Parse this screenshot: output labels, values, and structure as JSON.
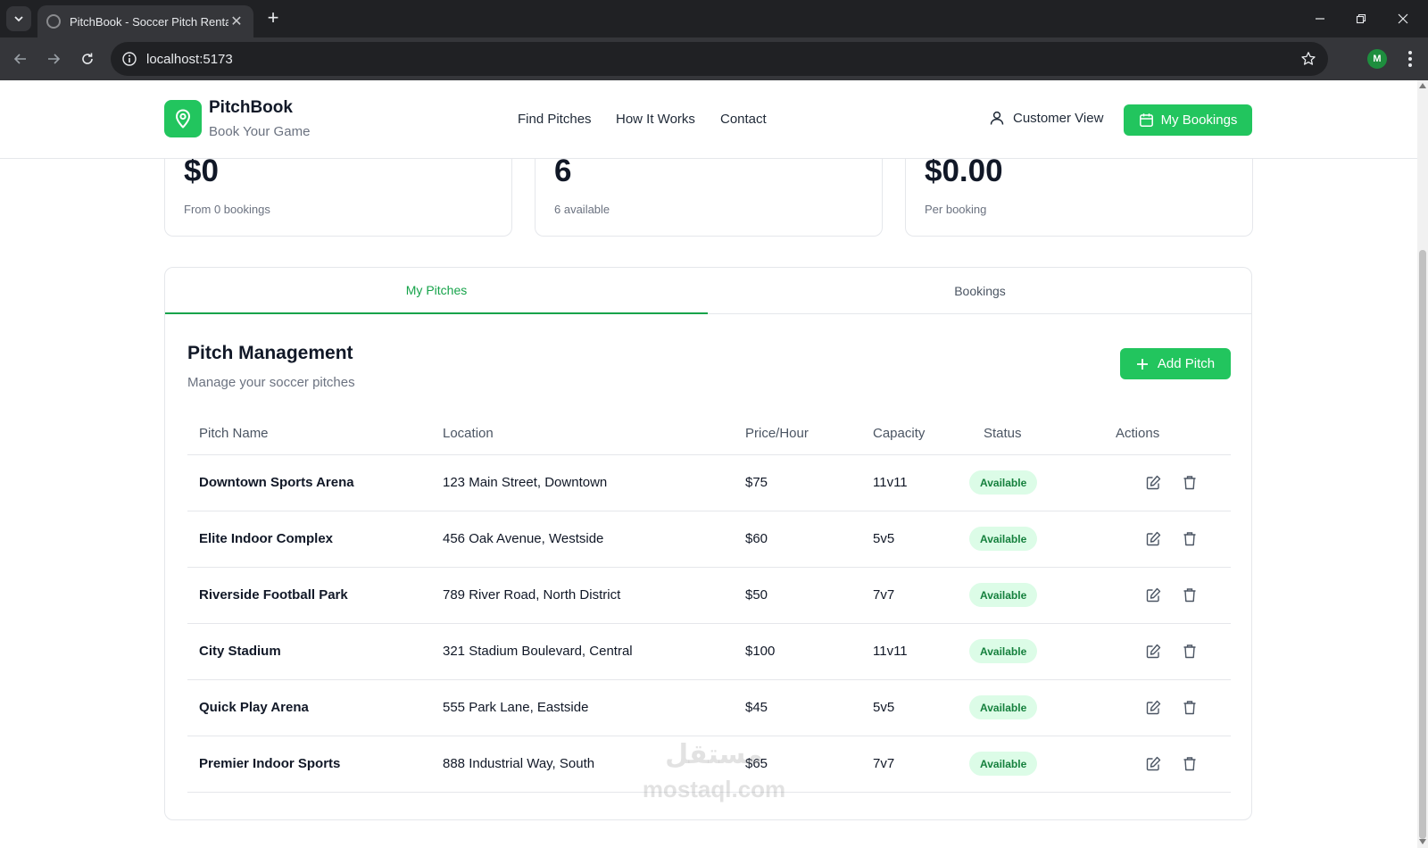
{
  "browser": {
    "tab_title": "PitchBook - Soccer Pitch Rental",
    "url": "localhost:5173",
    "profile_initial": "M"
  },
  "header": {
    "brand_name": "PitchBook",
    "brand_tagline": "Book Your Game",
    "nav": [
      "Find Pitches",
      "How It Works",
      "Contact"
    ],
    "customer_view": "Customer View",
    "my_bookings": "My Bookings"
  },
  "stats": [
    {
      "value": "$0",
      "sub": "From 0 bookings"
    },
    {
      "value": "6",
      "sub": "6 available"
    },
    {
      "value": "$0.00",
      "sub": "Per booking"
    }
  ],
  "tabs": [
    "My Pitches",
    "Bookings"
  ],
  "management": {
    "title": "Pitch Management",
    "subtitle": "Manage your soccer pitches",
    "add_button": "Add Pitch"
  },
  "table": {
    "headers": [
      "Pitch Name",
      "Location",
      "Price/Hour",
      "Capacity",
      "Status",
      "Actions"
    ],
    "rows": [
      {
        "name": "Downtown Sports Arena",
        "location": "123 Main Street, Downtown",
        "price": "$75",
        "capacity": "11v11",
        "status": "Available"
      },
      {
        "name": "Elite Indoor Complex",
        "location": "456 Oak Avenue, Westside",
        "price": "$60",
        "capacity": "5v5",
        "status": "Available"
      },
      {
        "name": "Riverside Football Park",
        "location": "789 River Road, North District",
        "price": "$50",
        "capacity": "7v7",
        "status": "Available"
      },
      {
        "name": "City Stadium",
        "location": "321 Stadium Boulevard, Central",
        "price": "$100",
        "capacity": "11v11",
        "status": "Available"
      },
      {
        "name": "Quick Play Arena",
        "location": "555 Park Lane, Eastside",
        "price": "$45",
        "capacity": "5v5",
        "status": "Available"
      },
      {
        "name": "Premier Indoor Sports",
        "location": "888 Industrial Way, South",
        "price": "$65",
        "capacity": "7v7",
        "status": "Available"
      }
    ]
  },
  "watermark": {
    "line1": "مستقل",
    "line2": "mostaql.com"
  },
  "colors": {
    "accent": "#22c55e",
    "accent_dark": "#16a34a",
    "badge_bg": "#dcfce7",
    "badge_text": "#15803d"
  }
}
